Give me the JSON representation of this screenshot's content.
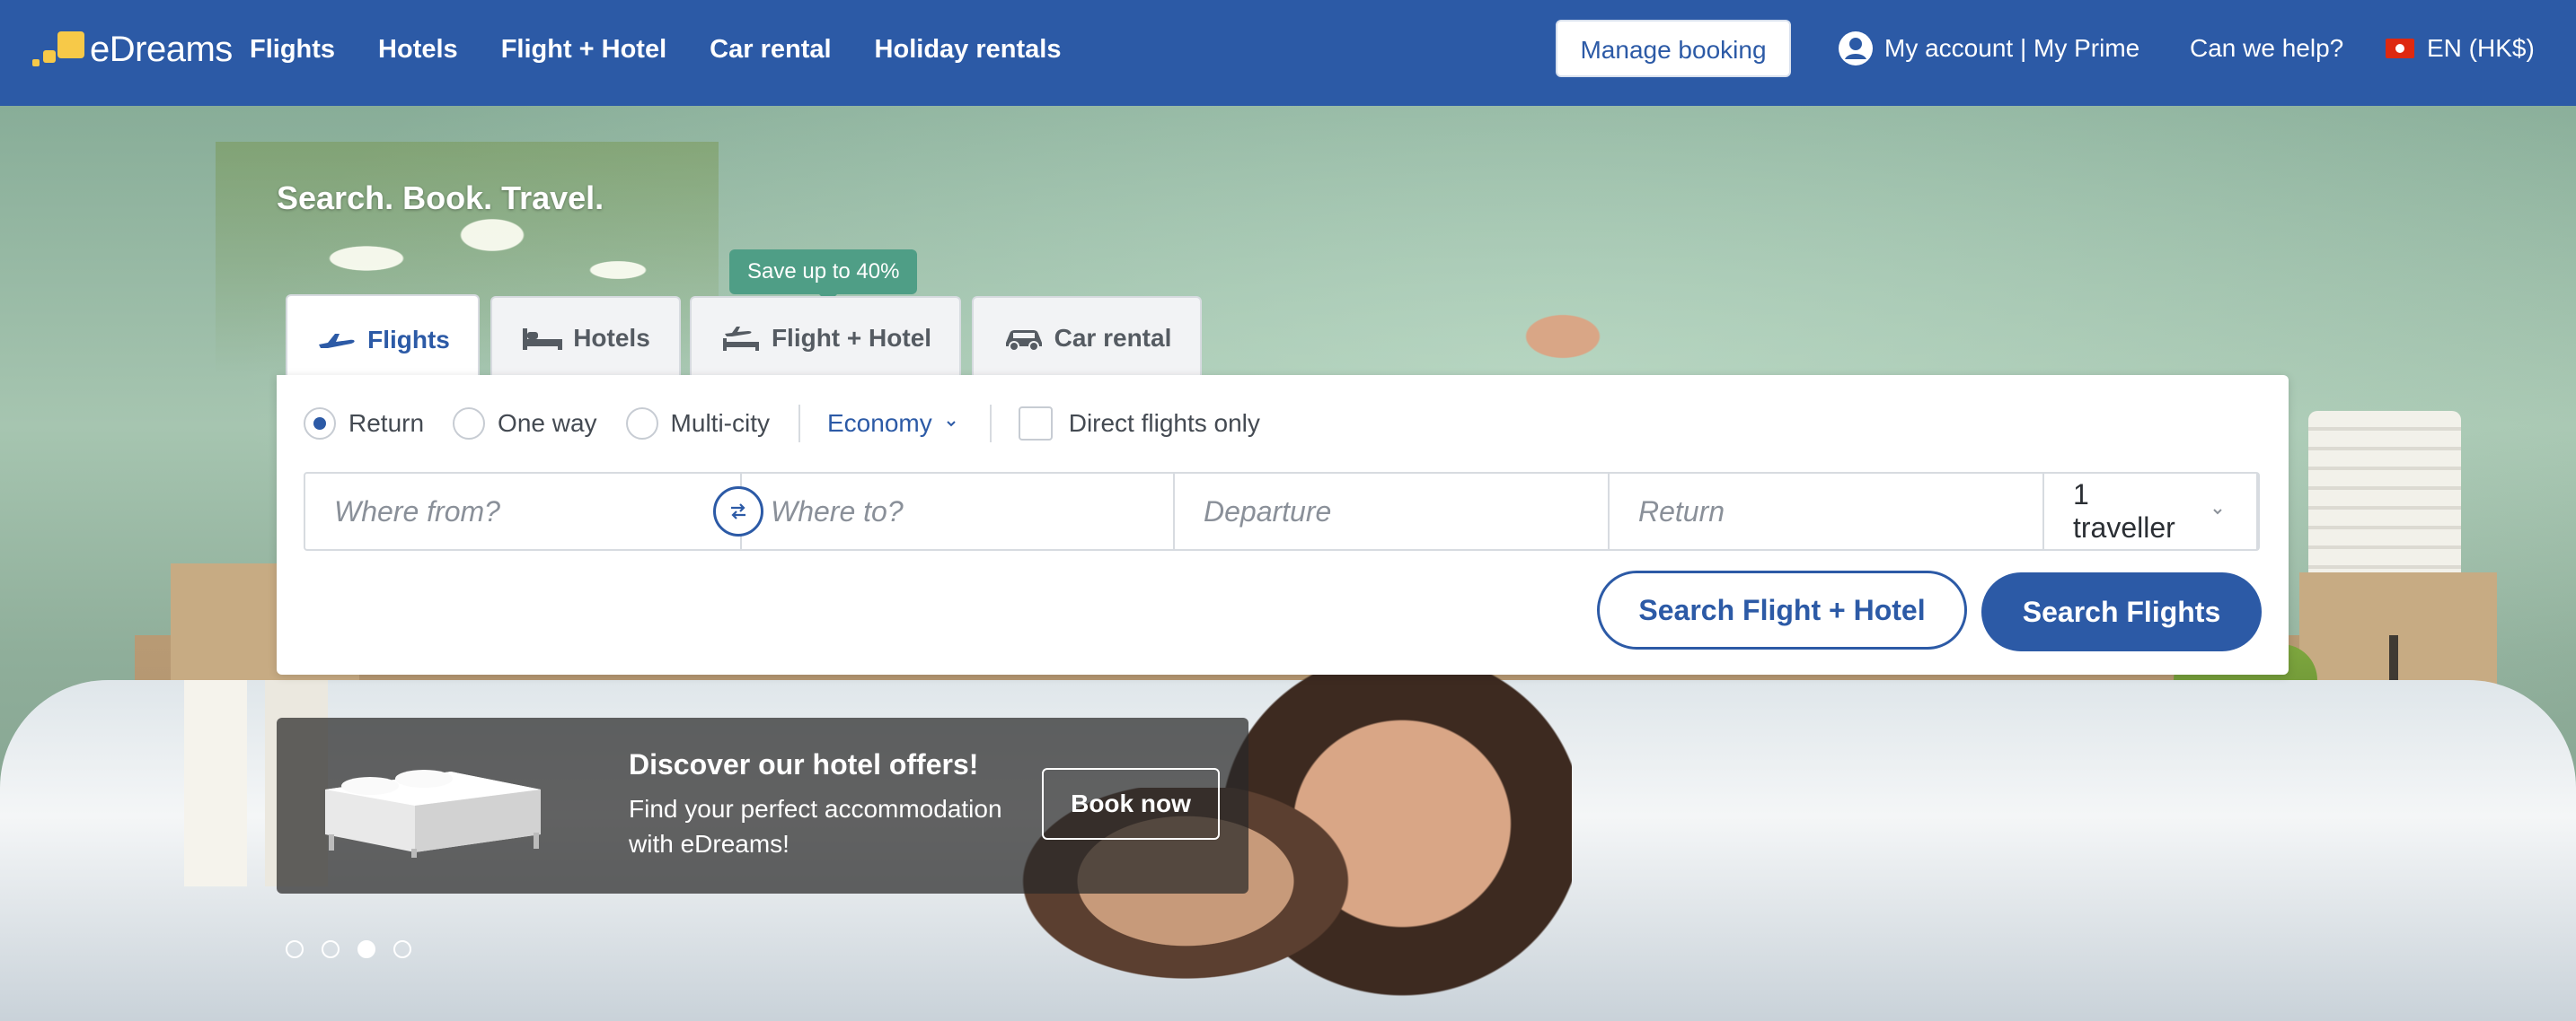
{
  "brand": {
    "name": "eDreams",
    "accent": "#2c5aa6",
    "logo_color": "#f7c948"
  },
  "nav": {
    "items": [
      {
        "label": "Flights"
      },
      {
        "label": "Hotels"
      },
      {
        "label": "Flight + Hotel"
      },
      {
        "label": "Car rental"
      },
      {
        "label": "Holiday rentals"
      }
    ]
  },
  "header": {
    "manage_booking": "Manage booking",
    "account": "My account | My Prime",
    "help": "Can we help?",
    "language": "EN (HK$)",
    "account_icon": "user-circle-icon",
    "flag_icon": "hong-kong-flag-icon"
  },
  "hero": {
    "title": "Search. Book. Travel."
  },
  "tabs": {
    "badge": "Save up to 40%",
    "items": [
      {
        "label": "Flights",
        "icon": "plane-icon",
        "active": true
      },
      {
        "label": "Hotels",
        "icon": "bed-icon",
        "active": false
      },
      {
        "label": "Flight + Hotel",
        "icon": "plane-bed-icon",
        "active": false
      },
      {
        "label": "Car rental",
        "icon": "car-icon",
        "active": false
      }
    ]
  },
  "search": {
    "trip_types": [
      {
        "label": "Return",
        "selected": true
      },
      {
        "label": "One way",
        "selected": false
      },
      {
        "label": "Multi-city",
        "selected": false
      }
    ],
    "cabin": "Economy",
    "direct_only": {
      "label": "Direct flights only",
      "checked": false
    },
    "from_placeholder": "Where from?",
    "to_placeholder": "Where to?",
    "departure_placeholder": "Departure",
    "return_placeholder": "Return",
    "travellers": "1 traveller",
    "search_fh": "Search Flight + Hotel",
    "search_flights": "Search Flights"
  },
  "promo": {
    "title": "Discover our hotel offers!",
    "text": "Find your perfect accommodation with eDreams!",
    "button": "Book now"
  },
  "carousel": {
    "count": 4,
    "active_index": 2
  }
}
